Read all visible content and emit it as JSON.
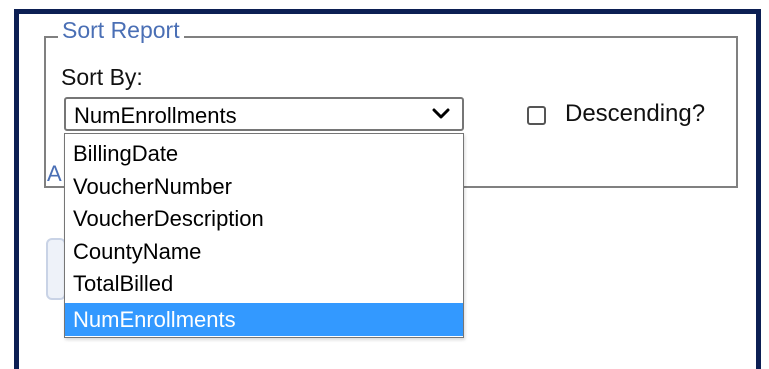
{
  "sort_report": {
    "legend": "Sort Report",
    "sort_by_label": "Sort By:",
    "select": {
      "value": "NumEnrollments",
      "options": [
        "BillingDate",
        "VoucherNumber",
        "VoucherDescription",
        "CountyName",
        "TotalBilled",
        "NumEnrollments"
      ],
      "selected_index": 5
    },
    "descending": {
      "label": "Descending?",
      "checked": false
    }
  },
  "colors": {
    "frame_border": "#0c1f54",
    "legend_text": "#4a6fb5",
    "selected_option_bg": "#3399ff"
  },
  "icons": {
    "select_chevron": "chevron-down-icon"
  }
}
